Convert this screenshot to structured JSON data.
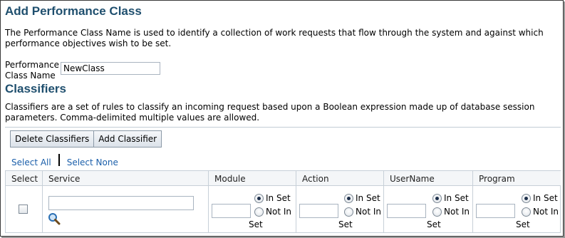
{
  "header": {
    "title": "Add Performance Class"
  },
  "intro": {
    "text": "The Performance Class Name is used to identify a collection of work requests that flow through the system and against which performance objectives wish to be set."
  },
  "name_field": {
    "label": "Performance Class Name",
    "value": "NewClass"
  },
  "classifiers": {
    "title": "Classifiers",
    "description": "Classifiers are a set of rules to classify an incoming request based upon a Boolean expression made up of database session parameters. Comma-delimited multiple values are allowed.",
    "buttons": {
      "delete": "Delete Classifiers",
      "add": "Add Classifier"
    },
    "links": {
      "select_all": "Select All",
      "select_none": "Select None"
    },
    "table": {
      "headers": [
        "Select",
        "Service",
        "Module",
        "Action",
        "UserName",
        "Program"
      ],
      "radio_in_set": "In Set",
      "radio_not_in": "Not In",
      "radio_set_suffix": "Set",
      "search_icon": "magnifier-icon"
    }
  }
}
